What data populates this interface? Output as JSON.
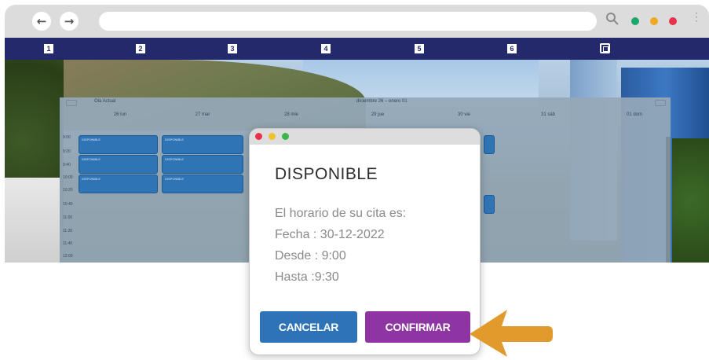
{
  "browser": {
    "back_glyph": "←",
    "forward_glyph": "→",
    "kebab_glyph": "⋮",
    "dots": [
      "#1aa86b",
      "#f2a922",
      "#e8324d"
    ],
    "tabs": [
      "1",
      "2",
      "3",
      "4",
      "5",
      "6"
    ]
  },
  "calendar": {
    "today_label": "Ola Actual",
    "range_label": "diciembre 26 – enero 01",
    "days": [
      "26 lun",
      "27 mar",
      "28 mie",
      "29 jue",
      "30 vie",
      "31 sáb",
      "01 dom"
    ],
    "hours": [
      "9:00",
      "9:20",
      "9:40",
      "10:00",
      "10:20",
      "10:40",
      "11:00",
      "11:20",
      "11:40",
      "12:00"
    ],
    "event_text": "DISPONIBLE"
  },
  "modal": {
    "window_dots": [
      "#e8324d",
      "#f2c12e",
      "#3cb54a"
    ],
    "title": "DISPONIBLE",
    "intro": "El horario de su cita es:",
    "fecha": "Fecha : 30-12-2022",
    "desde": "Desde : 9:00",
    "hasta": "Hasta :9:30",
    "cancel_label": "CANCELAR",
    "confirm_label": "CONFIRMAR"
  },
  "colors": {
    "nav_bar": "#24296b",
    "cancel_button": "#2e73b8",
    "confirm_button": "#8e35a3",
    "arrow": "#e19a2b"
  },
  "icons": [
    "arrow-left-icon",
    "arrow-right-icon",
    "search-icon",
    "kebab-menu-icon",
    "window-tab-icon",
    "pointer-arrow-icon"
  ]
}
